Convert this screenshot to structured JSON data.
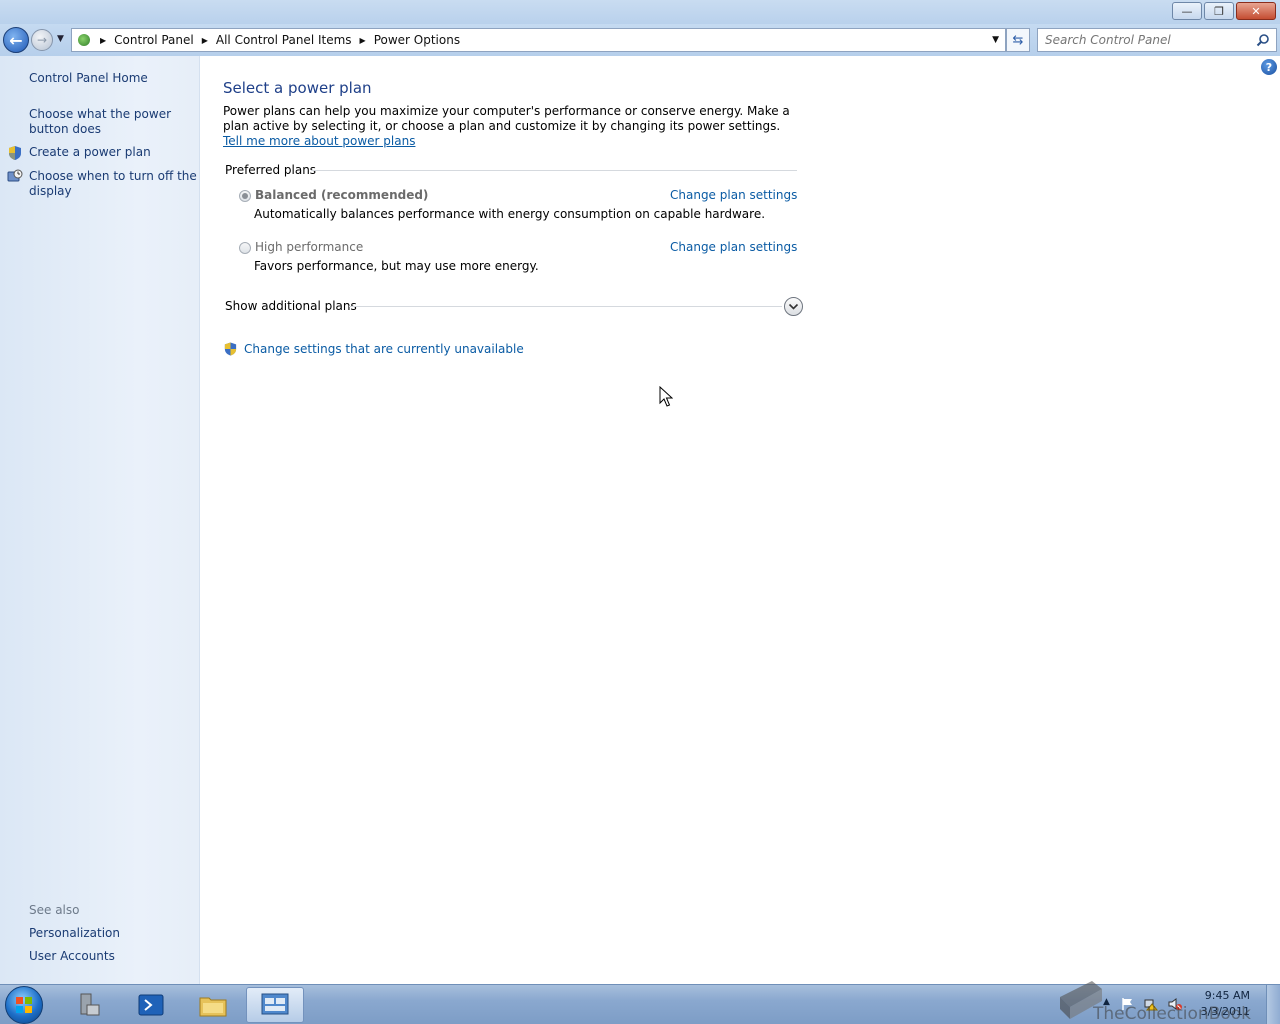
{
  "window": {
    "minimize_glyph": "—",
    "restore_glyph": "❐",
    "close_glyph": "✕"
  },
  "address": {
    "breadcrumbs": [
      "Control Panel",
      "All Control Panel Items",
      "Power Options"
    ],
    "search_placeholder": "Search Control Panel"
  },
  "sidebar": {
    "home": "Control Panel Home",
    "tasks": [
      {
        "label": "Choose what the power button does",
        "icon": "none"
      },
      {
        "label": "Create a power plan",
        "icon": "shield-icon"
      },
      {
        "label": "Choose when to turn off the display",
        "icon": "monitor-clock-icon"
      }
    ],
    "see_also_label": "See also",
    "see_also": [
      "Personalization",
      "User Accounts"
    ]
  },
  "main": {
    "title": "Select a power plan",
    "intro": "Power plans can help you maximize your computer's performance or conserve energy. Make a plan active by selecting it, or choose a plan and customize it by changing its power settings. ",
    "intro_link": "Tell me more about power plans",
    "preferred_label": "Preferred plans",
    "plans": [
      {
        "name": "Balanced (recommended)",
        "desc": "Automatically balances performance with energy consumption on capable hardware.",
        "link": "Change plan settings",
        "selected": true
      },
      {
        "name": "High performance",
        "desc": "Favors performance, but may use more energy.",
        "link": "Change plan settings",
        "selected": false
      }
    ],
    "show_additional": "Show additional plans",
    "unavailable_link": "Change settings that are currently unavailable"
  },
  "taskbar": {
    "time": "9:45 AM",
    "date": "3/3/2011",
    "watermark": "TheCollectionBook"
  },
  "colors": {
    "link": "#0a5ba4",
    "title": "#1e3f88",
    "sidebar_link": "#1a3b73"
  }
}
